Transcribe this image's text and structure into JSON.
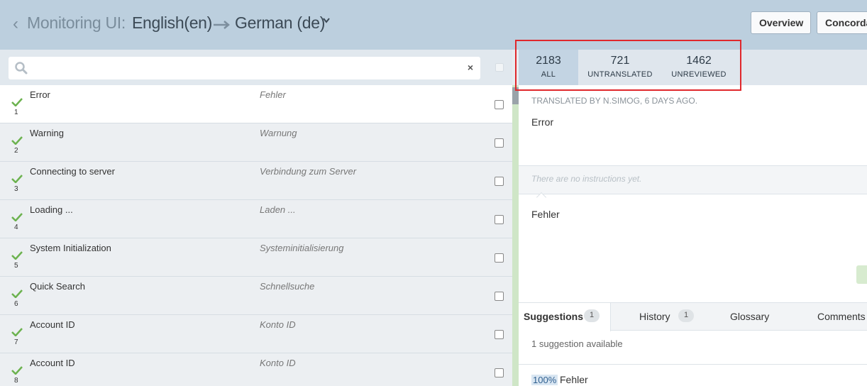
{
  "header": {
    "back_icon": "chevron-left-icon",
    "project": "Monitoring UI:",
    "source_lang": "English(en)",
    "target_lang": "German (de)",
    "overview_label": "Overview",
    "concordance_label": "Concordance"
  },
  "search": {
    "placeholder": "",
    "clear_label": "×"
  },
  "segments": [
    {
      "num": "1",
      "source": "Error",
      "target": "Fehler"
    },
    {
      "num": "2",
      "source": "Warning",
      "target": "Warnung"
    },
    {
      "num": "3",
      "source": "Connecting to server",
      "target": "Verbindung zum Server"
    },
    {
      "num": "4",
      "source": "Loading ...",
      "target": "Laden ..."
    },
    {
      "num": "5",
      "source": "System Initialization",
      "target": "Systeminitialisierung"
    },
    {
      "num": "6",
      "source": "Quick Search",
      "target": "Schnellsuche"
    },
    {
      "num": "7",
      "source": "Account ID",
      "target": "Konto ID"
    },
    {
      "num": "8",
      "source": "Account ID",
      "target": "Konto ID"
    }
  ],
  "filters": {
    "all": {
      "count": "2183",
      "label": "ALL"
    },
    "untranslated": {
      "count": "721",
      "label": "UNTRANSLATED"
    },
    "unreviewed": {
      "count": "1462",
      "label": "UNREVIEWED"
    }
  },
  "detail": {
    "meta": "TRANSLATED BY N.SIMOG, 6 DAYS AGO.",
    "source": "Error",
    "instructions": "There are no instructions yet.",
    "target": "Fehler"
  },
  "tabs": {
    "suggestions": {
      "label": "Suggestions",
      "badge": "1"
    },
    "history": {
      "label": "History",
      "badge": "1"
    },
    "glossary": {
      "label": "Glossary"
    },
    "comments": {
      "label": "Comments"
    }
  },
  "suggestions": {
    "available": "1 suggestion available",
    "items": [
      {
        "match": "100%",
        "text": "Fehler"
      }
    ]
  },
  "colors": {
    "header_bg": "#bccfde",
    "accent_check": "#6cb24f",
    "highlight_box": "#e0282c"
  }
}
